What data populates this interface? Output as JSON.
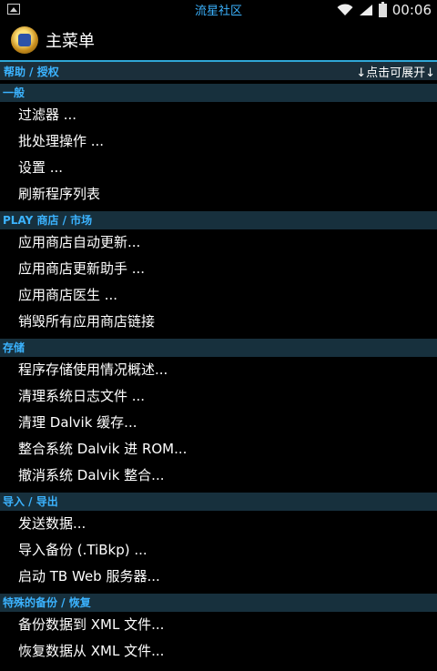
{
  "status_bar": {
    "carrier": "流星社区",
    "time": "00:06",
    "icons": [
      "notification-icon",
      "wifi-icon",
      "signal-icon",
      "battery-icon"
    ]
  },
  "action_bar": {
    "title": "主菜单",
    "logo": "titanium-backup-logo"
  },
  "help_bar": {
    "left": "帮助 / 授权",
    "right": "↓点击可展开↓"
  },
  "sections": [
    {
      "header": "一般",
      "items": [
        "过滤器 ...",
        "批处理操作 ...",
        "设置 ...",
        "刷新程序列表"
      ]
    },
    {
      "header": "PLAY 商店 / 市场",
      "items": [
        "应用商店自动更新...",
        "应用商店更新助手 ...",
        "应用商店医生 ...",
        "销毁所有应用商店链接"
      ]
    },
    {
      "header": "存储",
      "items": [
        "程序存储使用情况概述...",
        "清理系统日志文件 ...",
        "清理 Dalvik 缓存...",
        "整合系统 Dalvik 进 ROM...",
        "撤消系统 Dalvik 整合..."
      ]
    },
    {
      "header": "导入 / 导出",
      "items": [
        "发送数据...",
        "导入备份 (.TiBkp) ...",
        "启动 TB Web 服务器..."
      ]
    },
    {
      "header": "特殊的备份 / 恢复",
      "items": [
        "备份数据到 XML 文件...",
        "恢复数据从 XML 文件..."
      ]
    }
  ]
}
